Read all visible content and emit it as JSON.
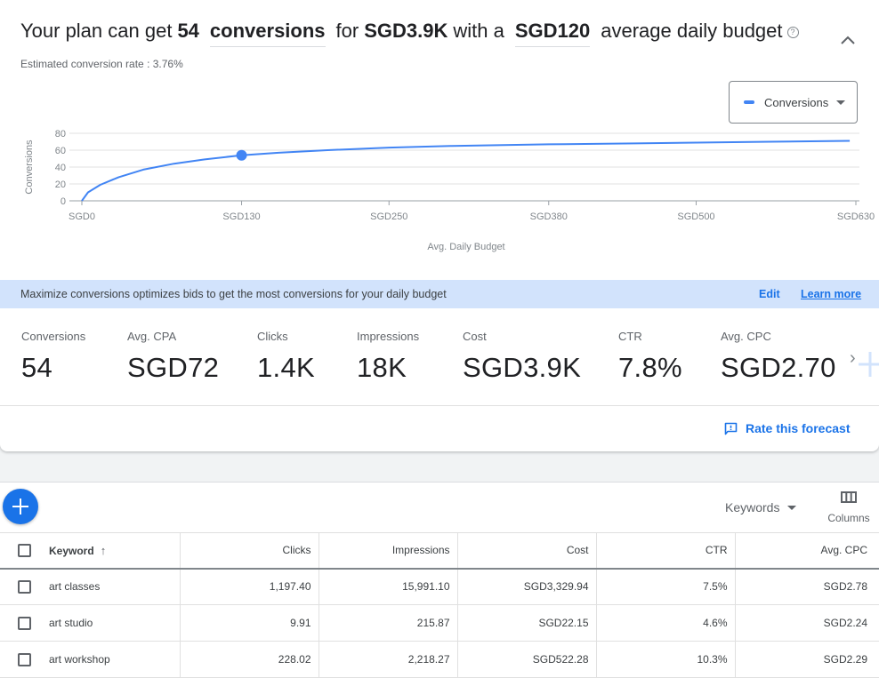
{
  "headline": {
    "prefix": "Your plan can get",
    "conversions": "54",
    "metric_select": "conversions",
    "for_label": "for",
    "cost": "SGD3.9K",
    "with_label": "with a",
    "budget_select": "SGD120",
    "suffix": "average daily budget",
    "help_icon": "?"
  },
  "conversion_rate": "Estimated conversion rate : 3.76%",
  "legend": {
    "label": "Conversions",
    "color": "#4285f4"
  },
  "chart_data": {
    "type": "line",
    "title": "",
    "xlabel": "Avg. Daily Budget",
    "ylabel": "Conversions",
    "xlim": [
      0,
      630
    ],
    "ylim": [
      0,
      80
    ],
    "x_ticks": [
      0,
      130,
      250,
      380,
      500,
      630
    ],
    "x_tick_labels": [
      "SGD0",
      "SGD130",
      "SGD250",
      "SGD380",
      "SGD500",
      "SGD630"
    ],
    "y_ticks": [
      0,
      20,
      40,
      60,
      80
    ],
    "y_tick_labels": [
      "0",
      "20",
      "40",
      "60",
      "80"
    ],
    "grid": true,
    "series": [
      {
        "name": "Conversions",
        "color": "#4285f4",
        "x": [
          0,
          5,
          15,
          30,
          50,
          75,
          100,
          130,
          160,
          200,
          250,
          300,
          380,
          450,
          500,
          560,
          625
        ],
        "y": [
          0,
          10,
          19,
          28,
          37,
          44,
          49,
          54,
          57,
          60,
          63,
          65,
          67,
          68,
          69,
          70,
          71
        ]
      }
    ],
    "highlight_point": {
      "x": 130,
      "y": 54
    }
  },
  "banner": {
    "text": "Maximize conversions optimizes bids to get the most conversions for your daily budget",
    "edit": "Edit",
    "learn_more": "Learn more"
  },
  "metrics": [
    {
      "label": "Conversions",
      "value": "54"
    },
    {
      "label": "Avg. CPA",
      "value": "SGD72"
    },
    {
      "label": "Clicks",
      "value": "1.4K"
    },
    {
      "label": "Impressions",
      "value": "18K"
    },
    {
      "label": "Cost",
      "value": "SGD3.9K"
    },
    {
      "label": "CTR",
      "value": "7.8%"
    },
    {
      "label": "Avg. CPC",
      "value": "SGD2.70"
    }
  ],
  "next_arrow": "›",
  "rate_forecast": "Rate this forecast",
  "toolbar": {
    "segment": "Keywords",
    "columns": "Columns"
  },
  "table": {
    "headers": [
      "Keyword",
      "Clicks",
      "Impressions",
      "Cost",
      "CTR",
      "Avg. CPC"
    ],
    "sort_icon": "↑",
    "rows": [
      [
        "art classes",
        "1,197.40",
        "15,991.10",
        "SGD3,329.94",
        "7.5%",
        "SGD2.78"
      ],
      [
        "art studio",
        "9.91",
        "215.87",
        "SGD22.15",
        "4.6%",
        "SGD2.24"
      ],
      [
        "art workshop",
        "228.02",
        "2,218.27",
        "SGD522.28",
        "10.3%",
        "SGD2.29"
      ]
    ]
  }
}
